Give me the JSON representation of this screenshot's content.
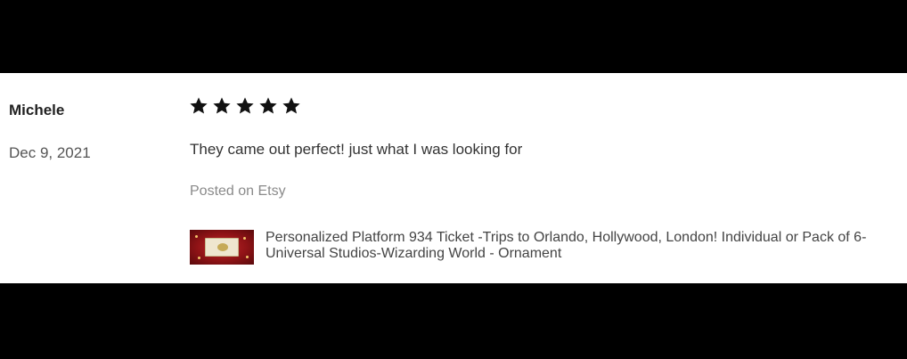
{
  "review": {
    "reviewer_name": "Michele",
    "date": "Dec 9, 2021",
    "rating": 5,
    "text": "They came out perfect! just what I was looking for",
    "posted_on": "Posted on Etsy",
    "product": {
      "title": "Personalized Platform 934 Ticket -Trips to Orlando, Hollywood, London! Individual or Pack of 6- Universal Studios-Wizarding World - Ornament",
      "thumbnail_icon": "ticket-ornament-image"
    }
  },
  "colors": {
    "star": "#111111",
    "text": "#333333",
    "muted": "#8a8a8a",
    "band": "#000000"
  }
}
